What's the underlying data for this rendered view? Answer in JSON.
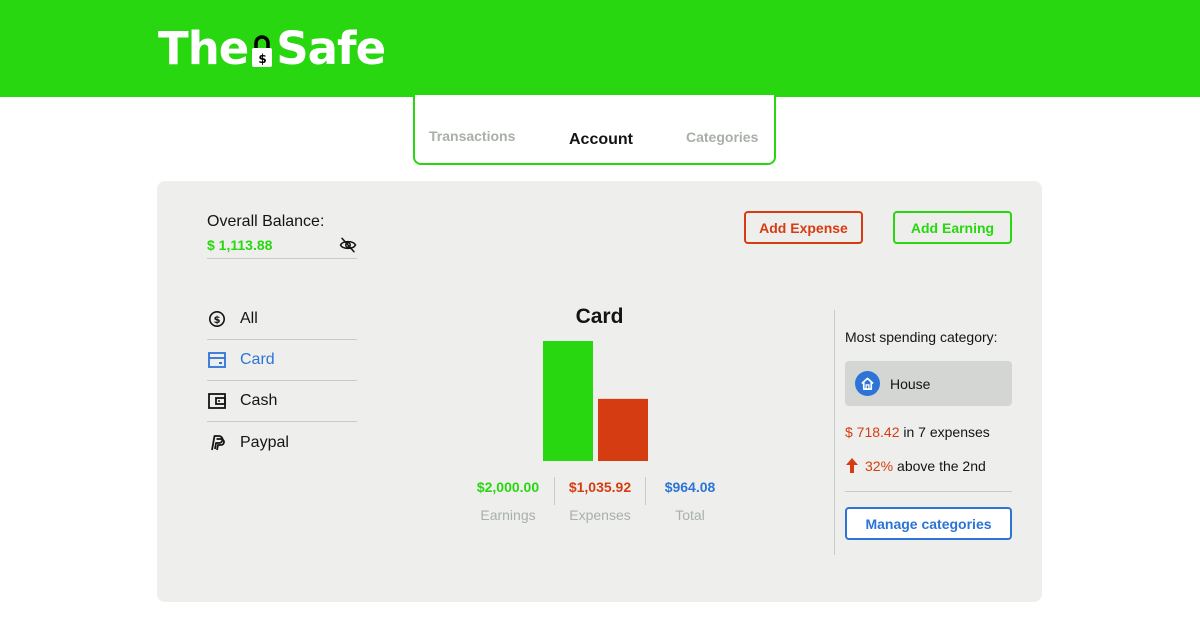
{
  "brand": {
    "name_left": "The",
    "name_right": "Safe",
    "logo_icon": "padlock-dollar-icon",
    "color": "#28d70f"
  },
  "tabs": [
    {
      "label": "Transactions",
      "active": false
    },
    {
      "label": "Account",
      "active": true
    },
    {
      "label": "Categories",
      "active": false
    }
  ],
  "balance": {
    "label": "Overall Balance:",
    "value": "$ 1,113.88",
    "toggle_icon": "eye-off-icon"
  },
  "actions": {
    "add_expense": "Add Expense",
    "add_earning": "Add Earning"
  },
  "accounts": [
    {
      "label": "All",
      "icon": "dollar-circle-icon",
      "active": false
    },
    {
      "label": "Card",
      "icon": "card-icon",
      "active": true
    },
    {
      "label": "Cash",
      "icon": "wallet-icon",
      "active": false
    },
    {
      "label": "Paypal",
      "icon": "paypal-icon",
      "active": false
    }
  ],
  "chart_data": {
    "type": "bar",
    "title": "Card",
    "categories": [
      "Earnings",
      "Expenses"
    ],
    "values": [
      2000.0,
      1035.92
    ],
    "colors": [
      "#28d70f",
      "#d63c11"
    ],
    "ylim": [
      0,
      2000
    ],
    "grid": false
  },
  "summary": [
    {
      "value": "$2,000.00",
      "label": "Earnings"
    },
    {
      "value": "$1,035.92",
      "label": "Expenses"
    },
    {
      "value": "$964.08",
      "label": "Total"
    }
  ],
  "insights": {
    "title": "Most spending category:",
    "category": {
      "name": "House",
      "icon": "home-icon"
    },
    "amount": "$ 718.42",
    "amount_suffix": "in 7 expenses",
    "percent": "32%",
    "percent_suffix": "above the 2nd",
    "trend_icon": "arrow-up-icon",
    "manage_label": "Manage categories"
  },
  "colors": {
    "green": "#28d70f",
    "red": "#d63c11",
    "blue": "#2d74d6",
    "panel": "#eeefec"
  }
}
